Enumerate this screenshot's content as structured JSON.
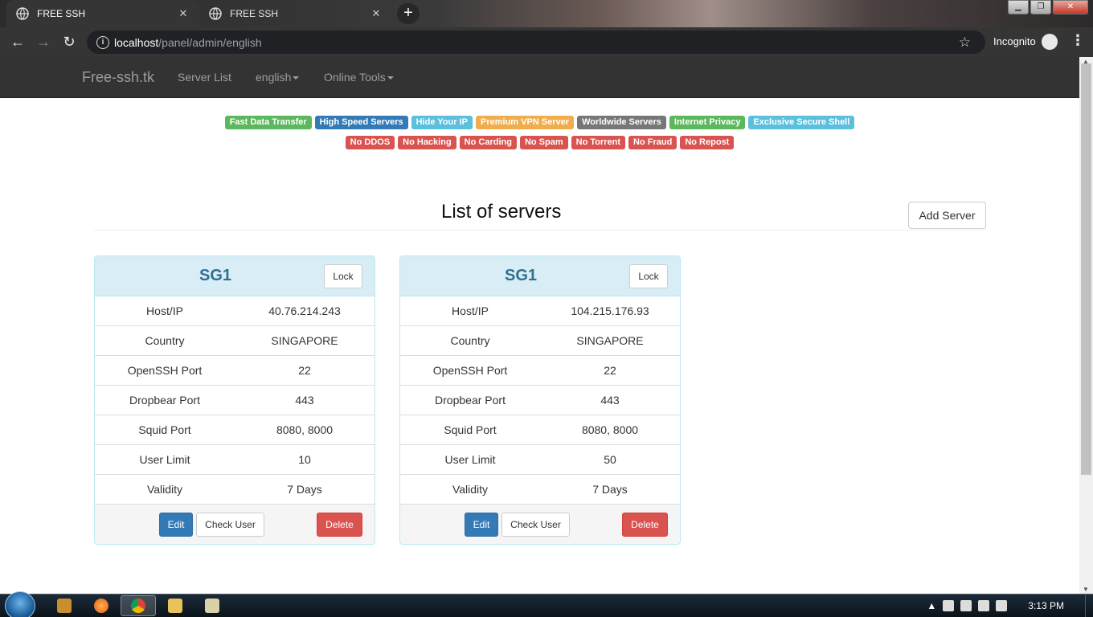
{
  "browser": {
    "tabs": [
      {
        "title": "FREE SSH"
      },
      {
        "title": "FREE SSH"
      }
    ],
    "url_host": "localhost",
    "url_path": "/panel/admin/english",
    "profile_label": "Incognito"
  },
  "navbar": {
    "brand": "Free-ssh.tk",
    "links": {
      "server_list": "Server List",
      "language": "english",
      "tools": "Online Tools"
    }
  },
  "features": [
    {
      "text": "Fast Data Transfer",
      "color": "#5cb85c"
    },
    {
      "text": "High Speed Servers",
      "color": "#337ab7"
    },
    {
      "text": "Hide Your IP",
      "color": "#5bc0de"
    },
    {
      "text": "Premium VPN Server",
      "color": "#f0ad4e"
    },
    {
      "text": "Worldwide Servers",
      "color": "#777777"
    },
    {
      "text": "Internet Privacy",
      "color": "#5cb85c"
    },
    {
      "text": "Exclusive Secure Shell",
      "color": "#5bc0de"
    }
  ],
  "rules": [
    "No DDOS",
    "No Hacking",
    "No Carding",
    "No Spam",
    "No Torrent",
    "No Fraud",
    "No Repost"
  ],
  "page": {
    "title": "List of servers",
    "add_button": "Add Server"
  },
  "servers": [
    {
      "name": "SG1",
      "lock": "Lock",
      "rows": [
        {
          "key": "Host/IP",
          "value": "40.76.214.243"
        },
        {
          "key": "Country",
          "value": "SINGAPORE"
        },
        {
          "key": "OpenSSH Port",
          "value": "22"
        },
        {
          "key": "Dropbear Port",
          "value": "443"
        },
        {
          "key": "Squid Port",
          "value": "8080, 8000"
        },
        {
          "key": "User Limit",
          "value": "10"
        },
        {
          "key": "Validity",
          "value": "7 Days"
        }
      ],
      "edit": "Edit",
      "check": "Check User",
      "delete": "Delete"
    },
    {
      "name": "SG1",
      "lock": "Lock",
      "rows": [
        {
          "key": "Host/IP",
          "value": "104.215.176.93"
        },
        {
          "key": "Country",
          "value": "SINGAPORE"
        },
        {
          "key": "OpenSSH Port",
          "value": "22"
        },
        {
          "key": "Dropbear Port",
          "value": "443"
        },
        {
          "key": "Squid Port",
          "value": "8080, 8000"
        },
        {
          "key": "User Limit",
          "value": "50"
        },
        {
          "key": "Validity",
          "value": "7 Days"
        }
      ],
      "edit": "Edit",
      "check": "Check User",
      "delete": "Delete"
    }
  ],
  "taskbar": {
    "clock": "3:13 PM",
    "apps": [
      "media-player-icon",
      "firefox-icon",
      "chrome-icon",
      "file-explorer-icon",
      "notepad-icon"
    ]
  }
}
